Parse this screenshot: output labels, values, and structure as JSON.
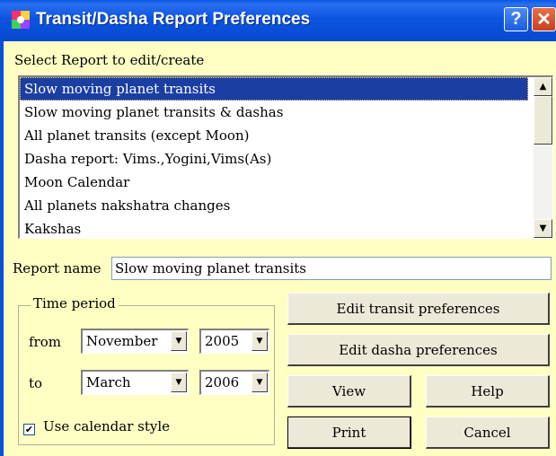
{
  "window": {
    "title": "Transit/Dasha Report Preferences"
  },
  "titlebar": {
    "help_glyph": "?",
    "close_glyph": "✕"
  },
  "select_label": "Select Report to edit/create",
  "reports": [
    "Slow moving planet transits",
    "Slow moving planet transits & dashas",
    "All planet transits (except Moon)",
    "Dasha report: Vims.,Yogini,Vims(As)",
    "Moon Calendar",
    "All planets nakshatra changes",
    "Kakshas"
  ],
  "selected_report_index": 0,
  "report_name": {
    "label": "Report name",
    "value": "Slow moving planet transits"
  },
  "time_period": {
    "legend": "Time period",
    "from_label": "from",
    "to_label": "to",
    "from_month": "November",
    "from_year": "2005",
    "to_month": "March",
    "to_year": "2006"
  },
  "buttons": {
    "edit_transit": "Edit transit preferences",
    "edit_dasha": "Edit dasha preferences",
    "view": "View",
    "help": "Help",
    "print": "Print",
    "cancel": "Cancel"
  },
  "calendar_style": {
    "label": "Use calendar style",
    "checked": true
  },
  "icons": [
    "app-icon",
    "help-icon",
    "close-icon",
    "scroll-up-arrow-icon",
    "scroll-down-arrow-icon",
    "dropdown-arrow-icon",
    "checkmark-icon"
  ],
  "colors": {
    "titlebar": "#0c54e0",
    "client_background": "#ffffc4",
    "selection": "#1b3ea3",
    "close_button": "#d6502a"
  }
}
